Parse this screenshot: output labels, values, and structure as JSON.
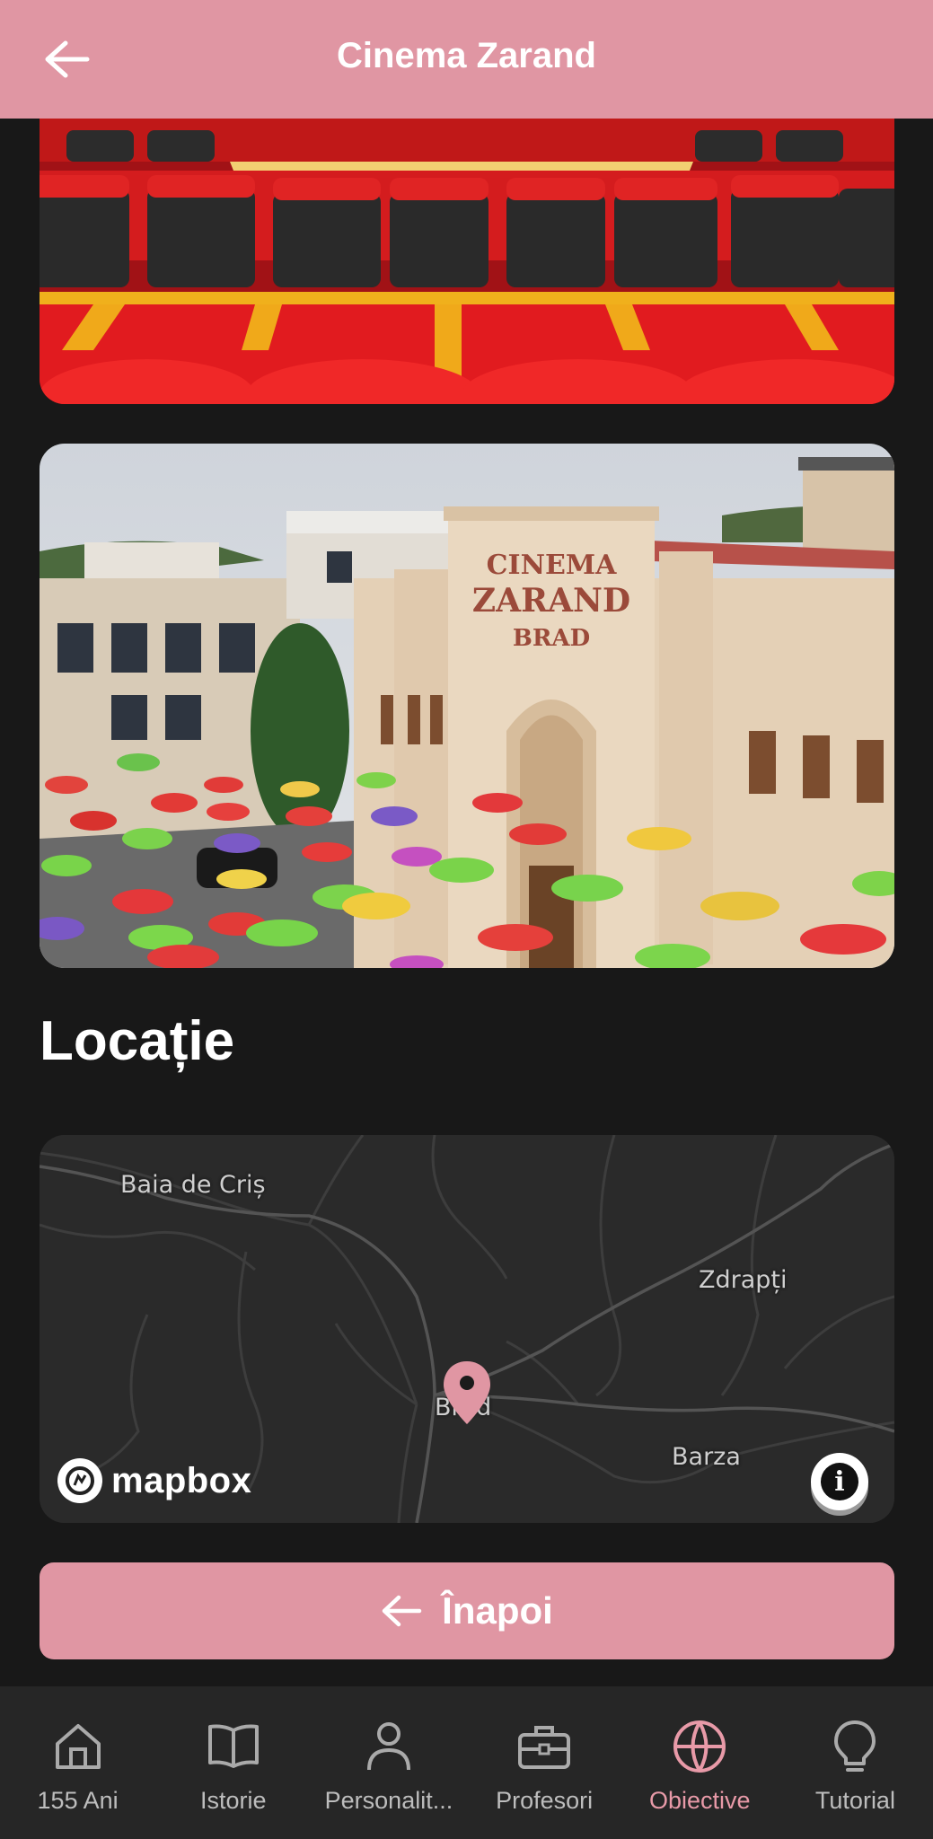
{
  "header": {
    "title": "Cinema Zarand",
    "back_icon": "arrow-left-icon"
  },
  "photos": [
    {
      "name": "cinema-seats-photo"
    },
    {
      "name": "cinema-building-photo",
      "sign_lines": [
        "CINEMA",
        "ZARAND",
        "BRAD"
      ]
    }
  ],
  "location": {
    "title": "Locație",
    "map": {
      "places": [
        "Baia de Criș",
        "Zdrapți",
        "Brad",
        "Barza"
      ],
      "logo_text": "mapbox",
      "info_label": "i"
    }
  },
  "back_button": {
    "label": "Înapoi",
    "icon": "arrow-left-icon"
  },
  "nav": {
    "items": [
      {
        "label": "155 Ani",
        "icon": "home-icon",
        "active": false
      },
      {
        "label": "Istorie",
        "icon": "book-icon",
        "active": false
      },
      {
        "label": "Personalit...",
        "icon": "person-icon",
        "active": false
      },
      {
        "label": "Profesori",
        "icon": "briefcase-icon",
        "active": false
      },
      {
        "label": "Obiective",
        "icon": "globe-icon",
        "active": true
      },
      {
        "label": "Tutorial",
        "icon": "lightbulb-icon",
        "active": false
      }
    ]
  },
  "colors": {
    "accent": "#e096a3",
    "background": "#181818",
    "nav_background": "#262626",
    "active_nav": "#e89aa8"
  }
}
